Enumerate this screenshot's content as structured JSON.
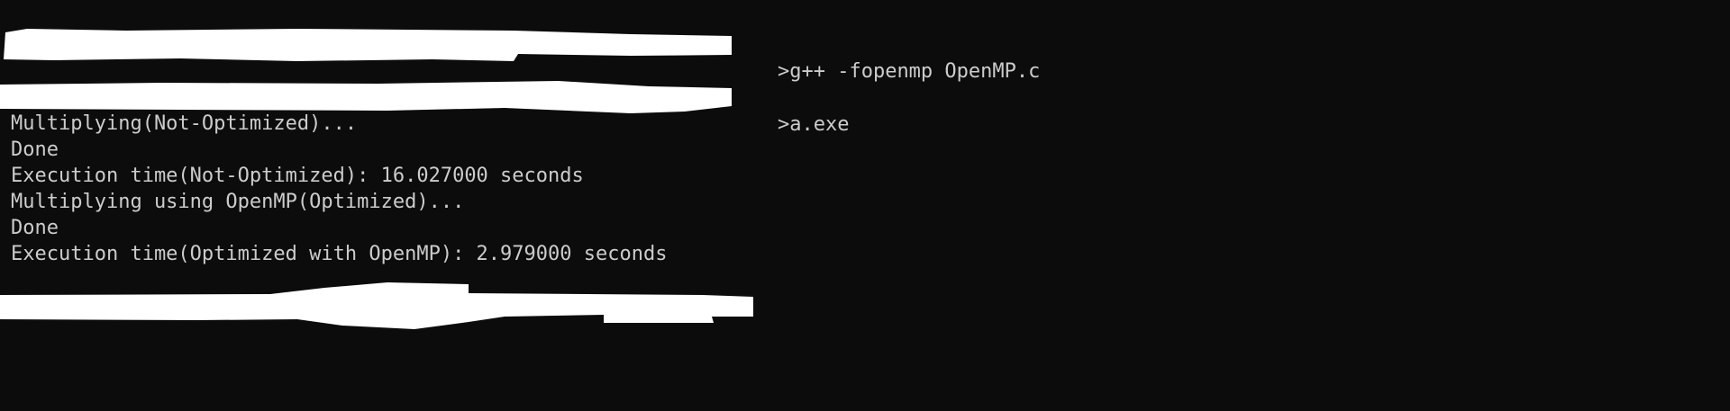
{
  "terminal": {
    "prompt1": {
      "separator": ">",
      "command": "g++ -fopenmp OpenMP.c"
    },
    "prompt2": {
      "separator": ">",
      "command": "a.exe"
    },
    "output": [
      "Multiplying(Not-Optimized)...",
      "Done",
      "Execution time(Not-Optimized): 16.027000 seconds",
      "Multiplying using OpenMP(Optimized)...",
      "Done",
      "Execution time(Optimized with OpenMP): 2.979000 seconds"
    ]
  },
  "colors": {
    "background": "#0c0c0c",
    "text": "#cccccc",
    "redaction": "#ffffff"
  }
}
